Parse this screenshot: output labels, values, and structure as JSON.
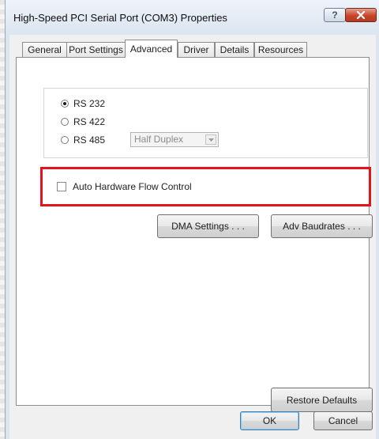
{
  "window": {
    "title": "High-Speed PCI Serial Port (COM3) Properties"
  },
  "titlebar": {
    "help_label": "?"
  },
  "tabs": [
    {
      "label": "General"
    },
    {
      "label": "Port Settings"
    },
    {
      "label": "Advanced",
      "active": true
    },
    {
      "label": "Driver"
    },
    {
      "label": "Details"
    },
    {
      "label": "Resources"
    }
  ],
  "mode": {
    "options": [
      {
        "label": "RS 232",
        "selected": true
      },
      {
        "label": "RS 422",
        "selected": false
      },
      {
        "label": "RS 485",
        "selected": false
      }
    ],
    "duplex": {
      "value": "Half Duplex",
      "enabled": false
    }
  },
  "flow_control": {
    "label": "Auto Hardware Flow Control",
    "checked": false
  },
  "buttons": {
    "dma": "DMA Settings . . .",
    "baud": "Adv Baudrates . . .",
    "restore": "Restore Defaults",
    "ok": "OK",
    "cancel": "Cancel"
  },
  "colors": {
    "highlight_box": "#e3141b",
    "close_button": "#c8442a"
  }
}
